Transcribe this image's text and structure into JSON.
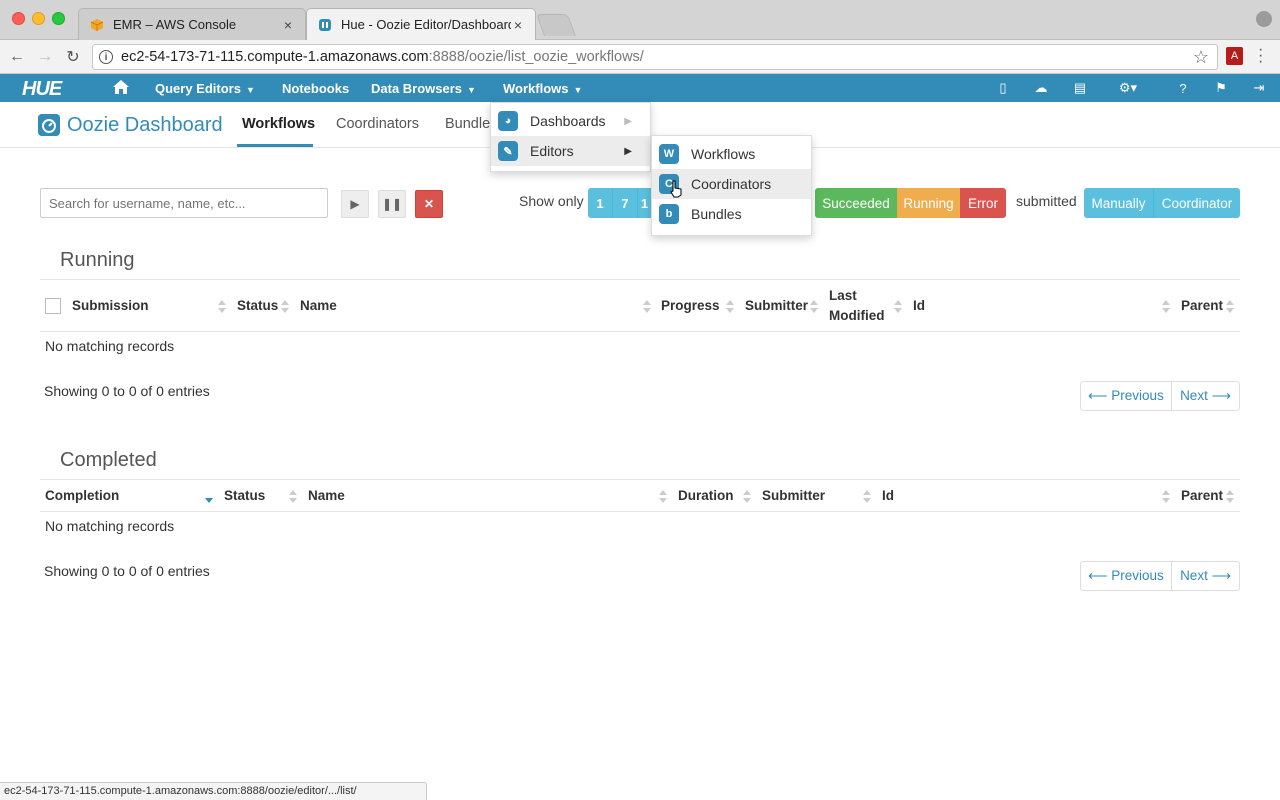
{
  "browser": {
    "tabs": [
      {
        "label": "EMR – AWS Console",
        "close": "×"
      },
      {
        "label": "Hue - Oozie Editor/Dashboard",
        "close": "×"
      }
    ],
    "url_host": "ec2-54-173-71-115.compute-1.amazonaws.com",
    "url_rest": ":8888/oozie/list_oozie_workflows/",
    "status_url": "ec2-54-173-71-115.compute-1.amazonaws.com:8888/oozie/editor/.../list/"
  },
  "hue_nav": {
    "logo": "HUE",
    "items": [
      {
        "label": "Query Editors"
      },
      {
        "label": "Notebooks"
      },
      {
        "label": "Data Browsers"
      },
      {
        "label": "Workflows"
      }
    ]
  },
  "page": {
    "title": "Oozie Dashboard",
    "tabs": [
      "Workflows",
      "Coordinators",
      "Bundles"
    ],
    "active_tab": "Workflows"
  },
  "filters": {
    "search_placeholder": "Search for username, name, etc...",
    "show_only_label": "Show only",
    "days": [
      "1",
      "7",
      "1"
    ],
    "status_buttons": [
      {
        "label": "Succeeded",
        "color": "#5cb85c"
      },
      {
        "label": "Running",
        "color": "#f0ad4e"
      },
      {
        "label": "Error",
        "color": "#d9534f"
      }
    ],
    "submitted_label": "submitted",
    "submit_buttons": [
      "Manually",
      "Coordinator"
    ]
  },
  "running": {
    "title": "Running",
    "columns": [
      "Submission",
      "Status",
      "Name",
      "Progress",
      "Submitter",
      "Last Modified",
      "Id",
      "Parent"
    ],
    "empty_text": "No matching records",
    "showing_text": "Showing 0 to 0 of 0 entries",
    "prev": "⟵ Previous",
    "next": "Next ⟶"
  },
  "completed": {
    "title": "Completed",
    "columns": [
      "Completion",
      "Status",
      "Name",
      "Duration",
      "Submitter",
      "Id",
      "Parent"
    ],
    "empty_text": "No matching records",
    "showing_text": "Showing 0 to 0 of 0 entries",
    "prev": "⟵ Previous",
    "next": "Next ⟶"
  },
  "workflows_menu": {
    "items": [
      {
        "label": "Dashboards",
        "icon": "dashboard-icon"
      },
      {
        "label": "Editors",
        "icon": "pencil-icon"
      }
    ],
    "editors_submenu": [
      {
        "label": "Workflows",
        "icon_letter": "W"
      },
      {
        "label": "Coordinators",
        "icon_letter": "C"
      },
      {
        "label": "Bundles",
        "icon_letter": "b"
      }
    ]
  },
  "colors": {
    "hue_blue": "#338bb8",
    "info_blue": "#5bc0de"
  }
}
